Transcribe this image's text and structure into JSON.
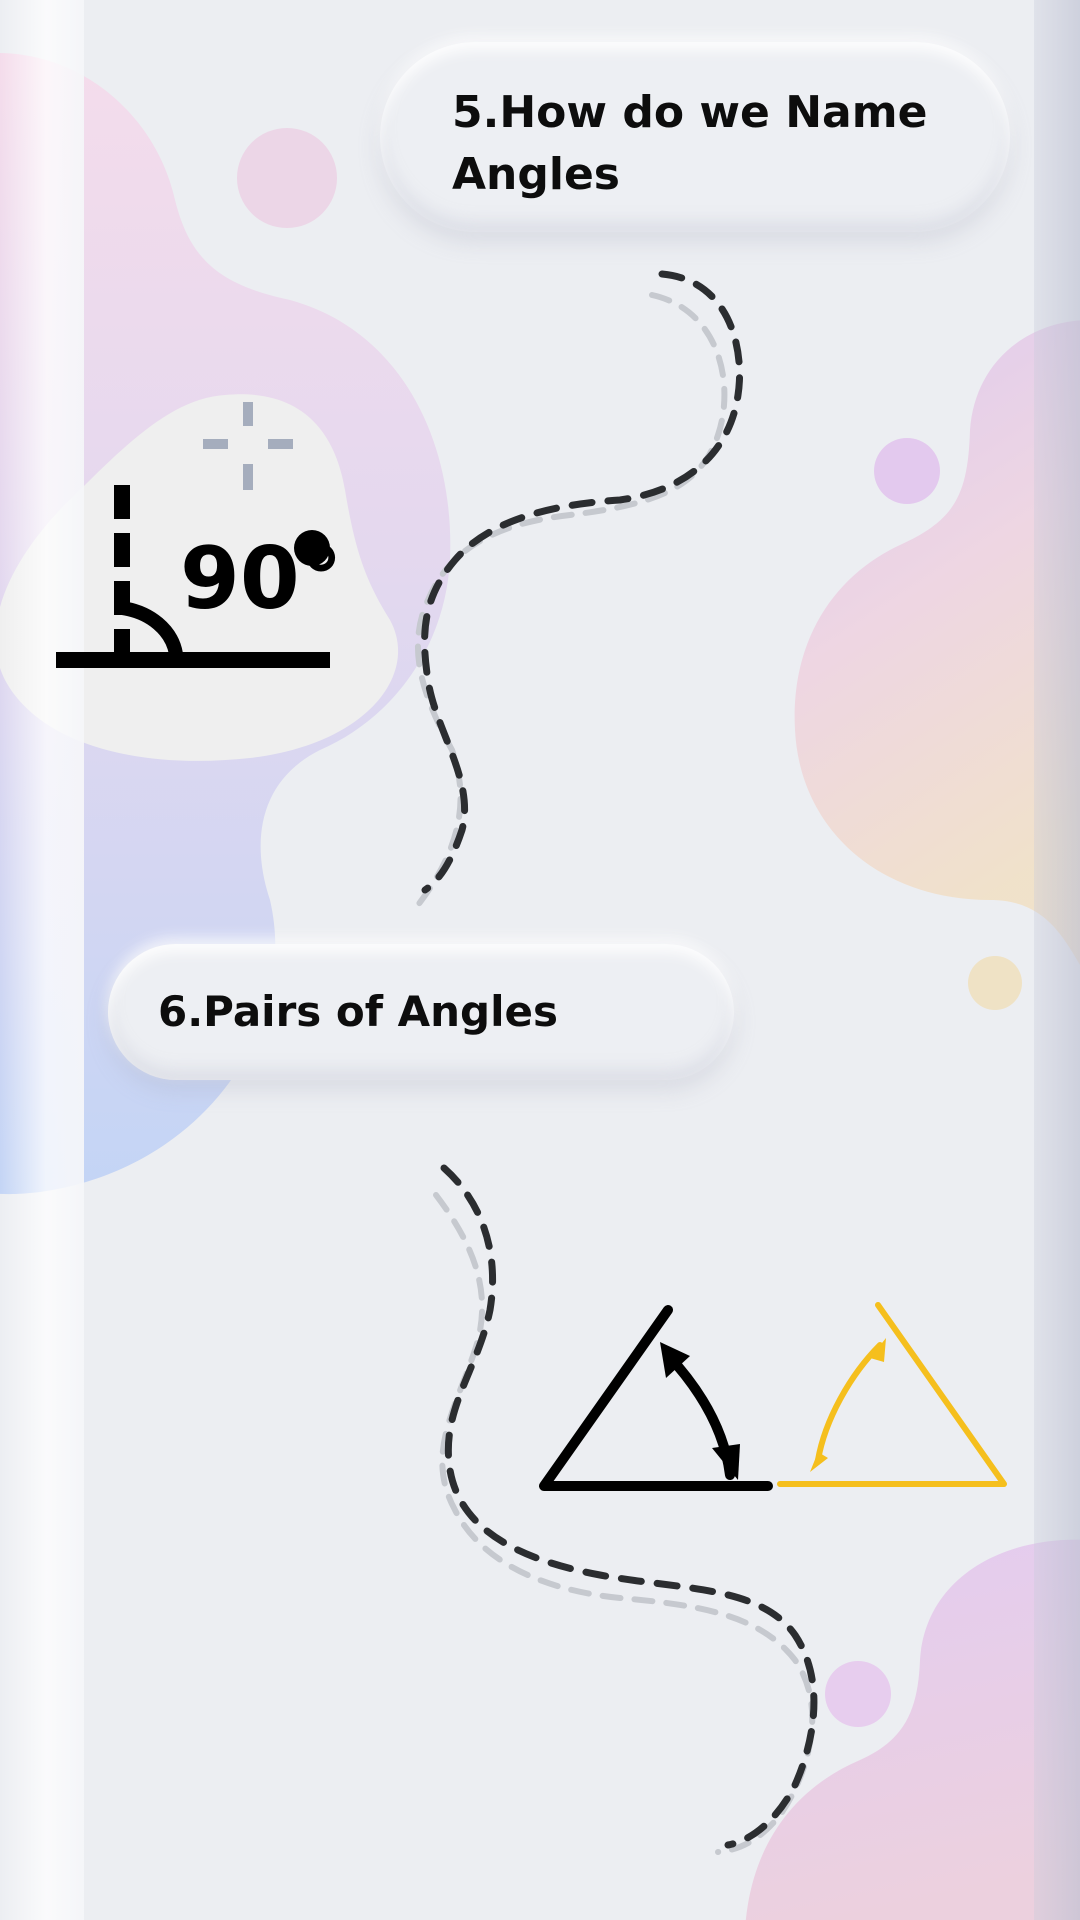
{
  "sections": [
    {
      "title": "5.How do we Name Angles"
    },
    {
      "title": "6.Pairs of Angles"
    }
  ],
  "icons": {
    "right_angle_label": "90°"
  },
  "colors": {
    "background": "#eceef2",
    "accent_yellow": "#f5bf1d",
    "ink": "#000000",
    "crosshair": "#a5adbd"
  }
}
